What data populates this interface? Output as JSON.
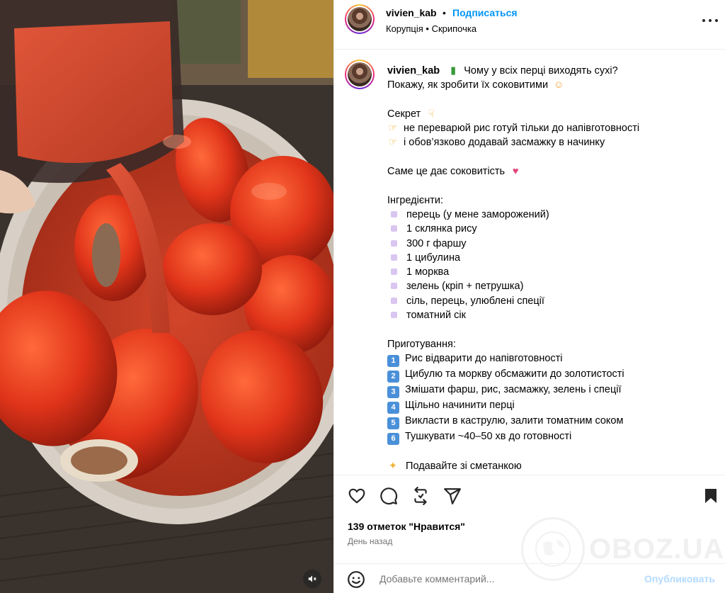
{
  "header": {
    "username": "vivien_kab",
    "separator": "•",
    "follow_label": "Подписаться",
    "location": "Корупція • Скрипочка"
  },
  "caption": {
    "username": "vivien_kab",
    "lines": [
      "Чому у всіх перці виходять сухі?",
      "Покажу, як зробити їх соковитими",
      "Секрет",
      "не переварюй рис готуй тільки до напівготовності",
      "і обов’язково додавай засмажку в начинку",
      "Саме це дає соковитість",
      "Інгредієнти:"
    ],
    "ingredients": [
      "перець (у мене заморожений)",
      "1 склянка рису",
      "300 г фаршу",
      "1 цибулина",
      "1 морква",
      "зелень (кріп + петрушка)",
      "сіль, перець, улюблені спеції",
      "томатний сік"
    ],
    "steps_title": "Приготування:",
    "steps": [
      {
        "n": "1",
        "text": "Рис відварити до напівготовності"
      },
      {
        "n": "2",
        "text": "Цибулю та моркву обсмажити до золотистості"
      },
      {
        "n": "3",
        "text": "Змішати фарш, рис, засмажку, зелень і спеції"
      },
      {
        "n": "4",
        "text": "Щільно начинити перці"
      },
      {
        "n": "5",
        "text": "Викласти в каструлю, залити томатним соком"
      },
      {
        "n": "6",
        "text": "Тушкувати ~40–50 хв до готовності"
      }
    ],
    "closing": "Подавайте зі сметанкою"
  },
  "icons": {
    "like": "heart-icon",
    "comment": "comment-icon",
    "share": "repost-icon",
    "send": "send-icon",
    "save": "bookmark-icon",
    "more": "more-icon",
    "emoji": "emoji-icon",
    "mute": "mute-icon"
  },
  "likes": "139 отметок \"Нравится\"",
  "time": "День назад",
  "comment": {
    "placeholder": "Добавьте комментарий...",
    "post_label": "Опубликовать"
  },
  "watermark": "OBOZ.UA",
  "colors": {
    "accent": "#0095f6",
    "post_disabled": "#b3dbff",
    "muted_text": "#737373"
  }
}
